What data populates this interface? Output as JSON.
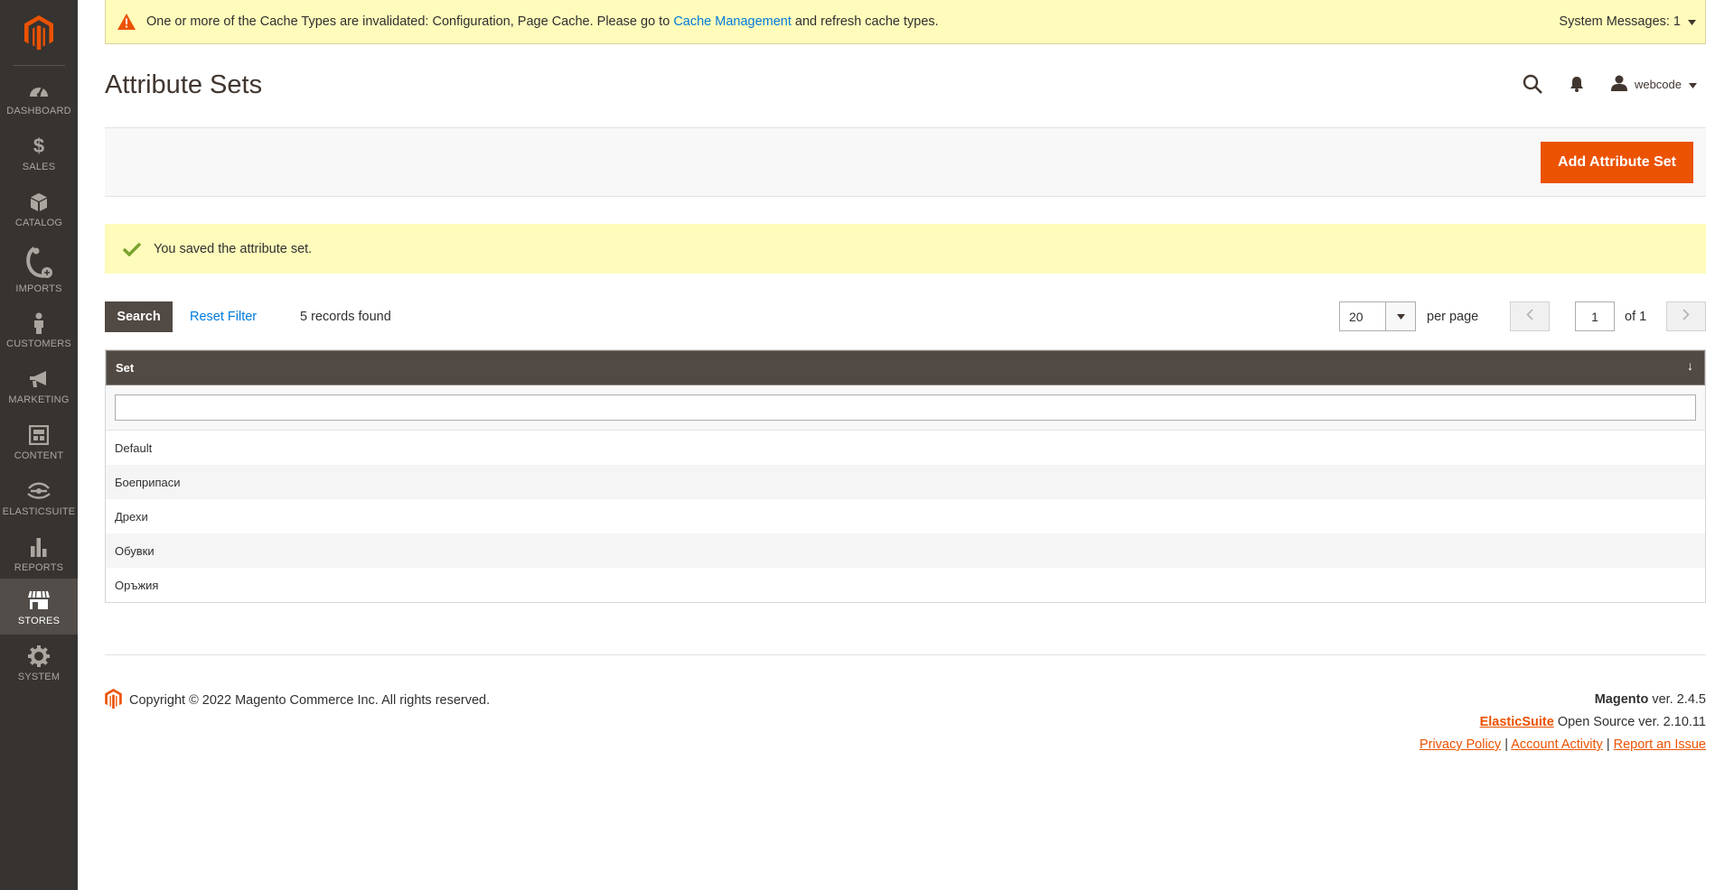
{
  "notice": {
    "text_before": "One or more of the Cache Types are invalidated: Configuration, Page Cache. Please go to",
    "link_text": "Cache Management",
    "text_after": "and refresh cache types.",
    "system_messages": "System Messages: 1"
  },
  "sidebar": {
    "items": [
      {
        "label": "DASHBOARD",
        "icon": "dashboard-icon"
      },
      {
        "label": "SALES",
        "icon": "dollar-icon"
      },
      {
        "label": "CATALOG",
        "icon": "box-icon"
      },
      {
        "label": "IMPORTS",
        "icon": "imports-icon"
      },
      {
        "label": "CUSTOMERS",
        "icon": "person-icon"
      },
      {
        "label": "MARKETING",
        "icon": "megaphone-icon"
      },
      {
        "label": "CONTENT",
        "icon": "content-icon"
      },
      {
        "label": "ELASTICSUITE",
        "icon": "elasticsuite-icon"
      },
      {
        "label": "REPORTS",
        "icon": "bar-chart-icon"
      },
      {
        "label": "STORES",
        "icon": "store-icon"
      },
      {
        "label": "SYSTEM",
        "icon": "gear-icon"
      }
    ],
    "active": "STORES"
  },
  "header": {
    "title": "Attribute Sets",
    "user": "webcode"
  },
  "actions": {
    "add_label": "Add Attribute Set"
  },
  "message": {
    "text": "You saved the attribute set."
  },
  "toolbar": {
    "search_label": "Search",
    "reset_label": "Reset Filter",
    "records": "5 records found",
    "limit": "20",
    "per_page": "per page",
    "page": "1",
    "of_pages": "of 1"
  },
  "grid": {
    "column": "Set",
    "sort_indicator": "↓",
    "rows": [
      "Default",
      "Боеприпаси",
      "Дрехи",
      "Обувки",
      "Оръжия"
    ]
  },
  "footer": {
    "copyright": "Copyright © 2022 Magento Commerce Inc. All rights reserved.",
    "magento": "Magento",
    "magento_ver": "ver. 2.4.5",
    "elasticsuite": "ElasticSuite",
    "elasticsuite_ver": "Open Source ver. 2.10.11",
    "links": [
      "Privacy Policy",
      "Account Activity",
      "Report an Issue"
    ]
  },
  "colors": {
    "sidebar_bg": "#373330",
    "accent": "#eb5202",
    "notice_bg": "#fffbbb",
    "grid_header": "#514943",
    "link": "#007bdb"
  }
}
